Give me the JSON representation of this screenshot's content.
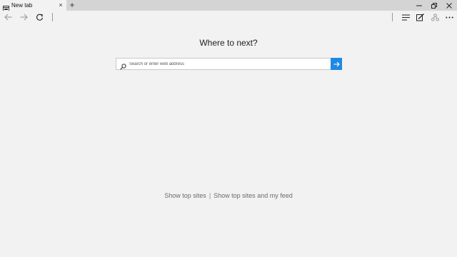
{
  "tab": {
    "title": "New tab",
    "close_glyph": "×"
  },
  "new_tab_glyph": "+",
  "icons": {
    "tab": "browser-tab-icon",
    "back": "back-arrow-icon",
    "forward": "forward-arrow-icon",
    "refresh": "refresh-icon",
    "hub": "hub-icon",
    "web_note": "web-note-icon",
    "share": "share-icon",
    "more": "more-icon",
    "search": "search-icon",
    "go": "go-arrow-icon"
  },
  "main": {
    "heading": "Where to next?",
    "search_placeholder": "Search or enter web address"
  },
  "bottom_links": {
    "top_sites": "Show top sites",
    "separator": "|",
    "top_sites_feed": "Show top sites and my feed"
  },
  "colors": {
    "accent": "#1e88e5",
    "background": "#f2f2f2",
    "tab_strip": "#d4d4d4"
  }
}
